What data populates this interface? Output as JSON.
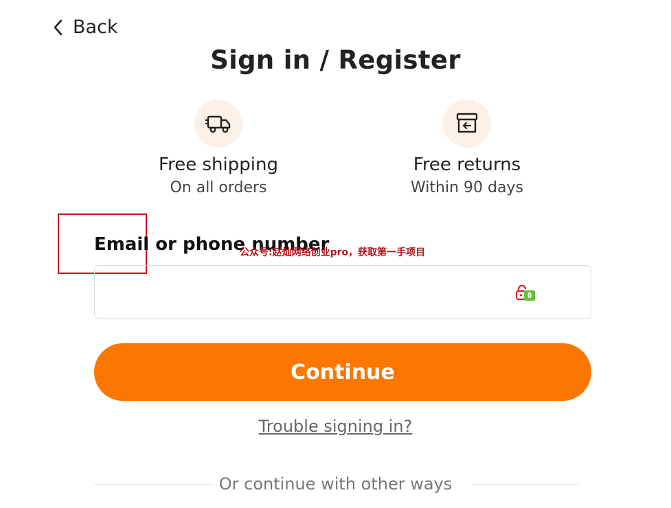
{
  "nav": {
    "back_label": "Back"
  },
  "page": {
    "title": "Sign in / Register"
  },
  "benefits": [
    {
      "icon": "truck-icon",
      "title": "Free shipping",
      "subtitle": "On all orders"
    },
    {
      "icon": "return-box-icon",
      "title": "Free returns",
      "subtitle": "Within 90 days"
    }
  ],
  "form": {
    "label": "Email or phone number",
    "input_value": "",
    "input_placeholder": "",
    "password_manager_count": "0",
    "continue_label": "Continue",
    "trouble_link": "Trouble signing in?",
    "alt_divider_text": "Or continue with other ways"
  },
  "overlay": {
    "watermark": "公众号:赵灿网络创业pro，获取第一手项目"
  },
  "colors": {
    "accent": "#fb7701",
    "icon_bg": "#fdf0e6",
    "annotation": "#cc1122",
    "badge": "#6abf3a"
  }
}
